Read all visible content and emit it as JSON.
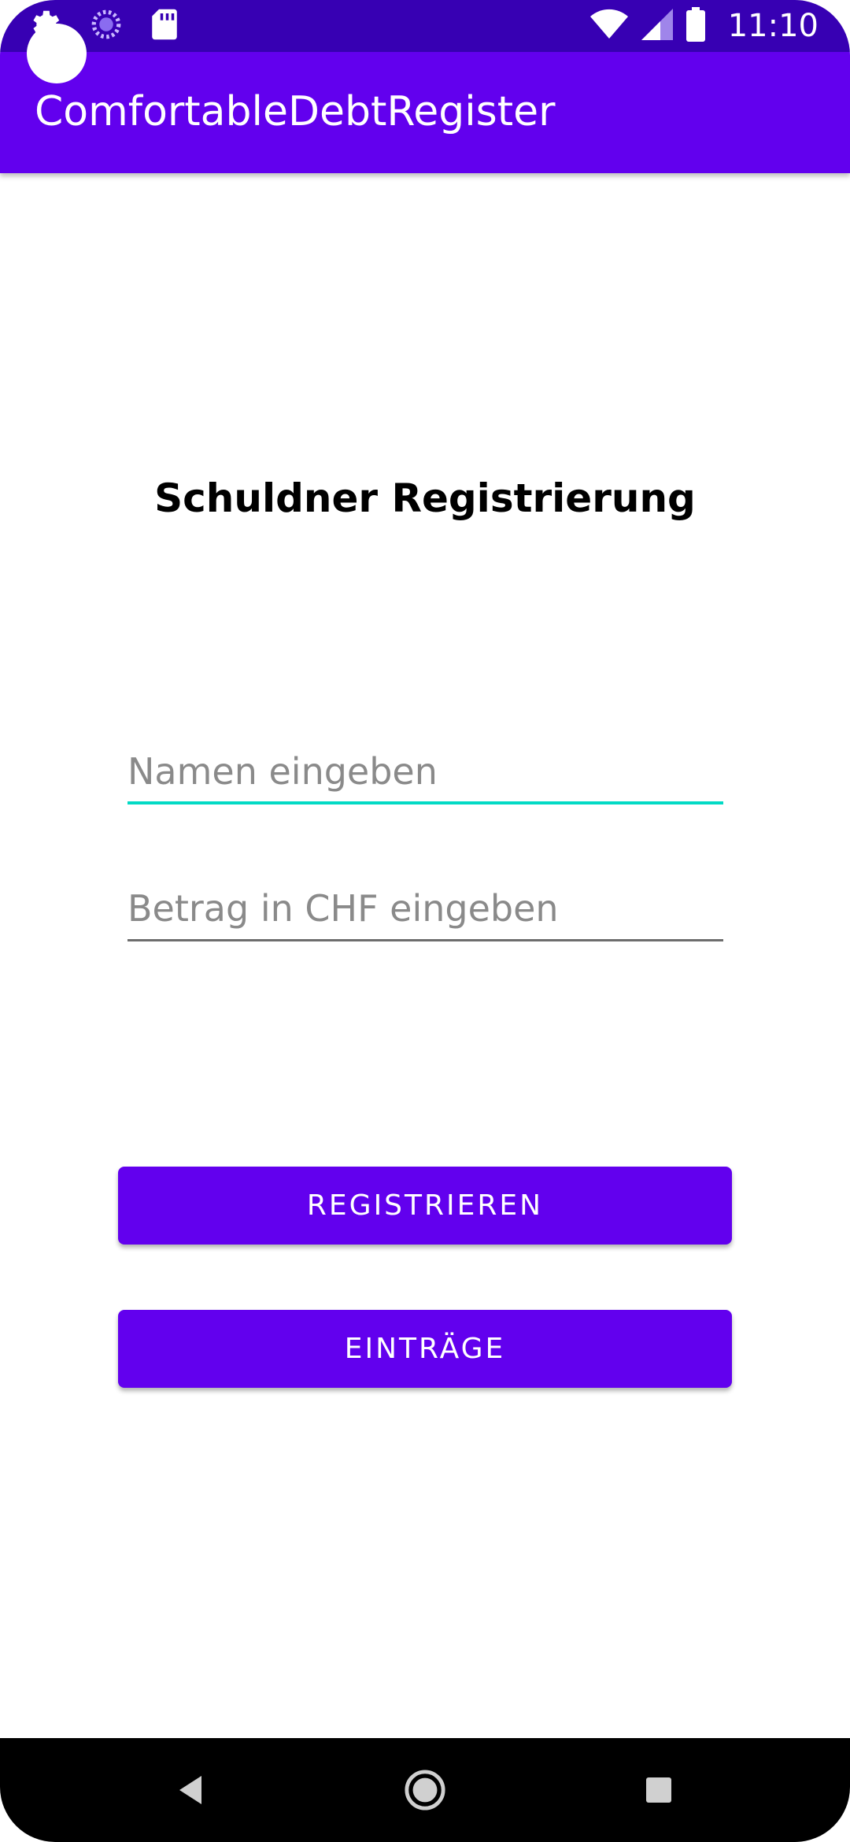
{
  "status_bar": {
    "time": "11:10",
    "icons": [
      "settings-icon",
      "sync-icon",
      "sd-card-icon",
      "wifi-icon",
      "signal-icon",
      "battery-icon"
    ]
  },
  "toolbar": {
    "title": "ComfortableDebtRegister"
  },
  "main": {
    "heading": "Schuldner Registrierung",
    "name_field": {
      "value": "",
      "placeholder": "Namen eingeben"
    },
    "amount_field": {
      "value": "",
      "placeholder": "Betrag in CHF eingeben"
    },
    "register_button": "REGISTRIEREN",
    "entries_button": "EINTRÄGE"
  },
  "navigation": {
    "icons": [
      "back-icon",
      "home-icon",
      "recents-icon"
    ]
  },
  "colors": {
    "status_bar": "#3700b3",
    "primary": "#6200ee",
    "accent": "#03dac5"
  }
}
